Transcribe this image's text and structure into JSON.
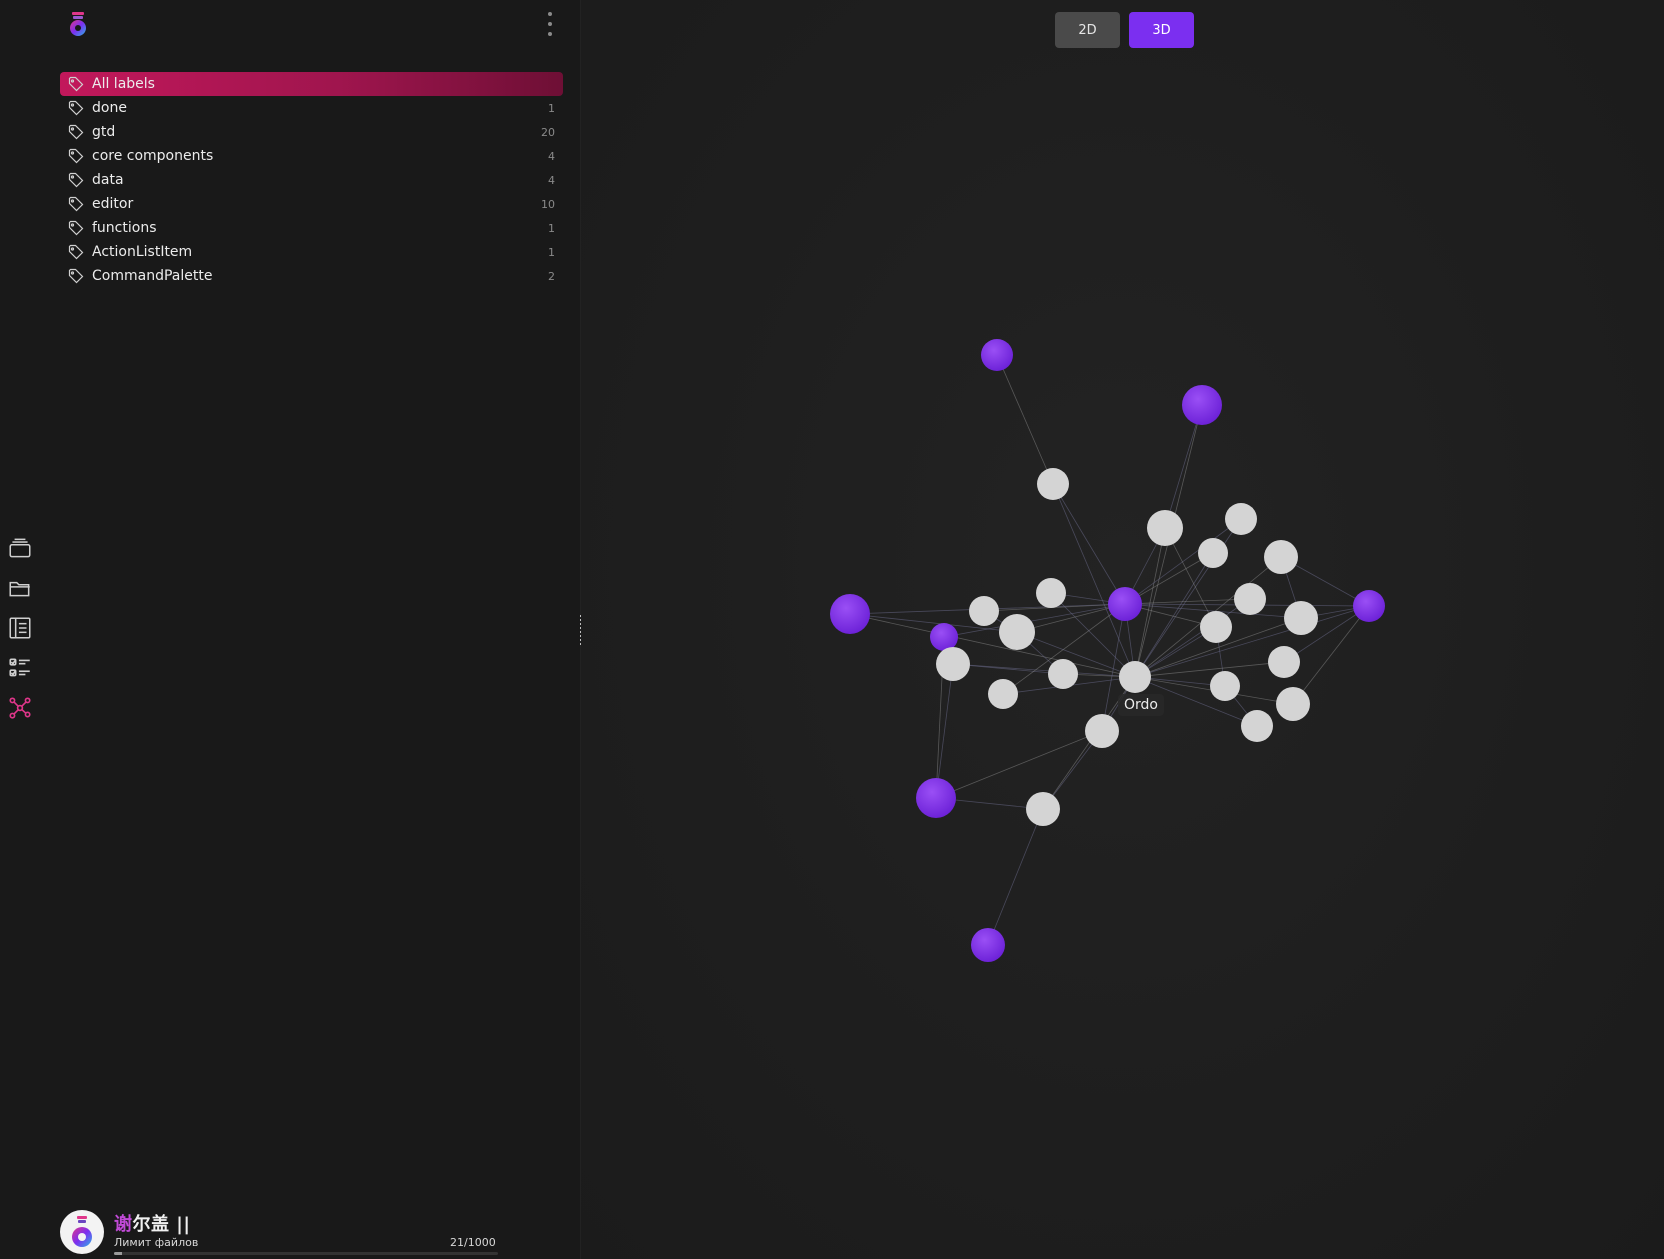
{
  "rail": {
    "items": [
      {
        "name": "inbox-icon"
      },
      {
        "name": "folder-icon"
      },
      {
        "name": "notes-icon"
      },
      {
        "name": "tasks-icon"
      },
      {
        "name": "graph-icon",
        "active": true
      }
    ]
  },
  "sidebar": {
    "labels": [
      {
        "text": "All labels",
        "count": "",
        "active": true
      },
      {
        "text": "done",
        "count": "1"
      },
      {
        "text": "gtd",
        "count": "20"
      },
      {
        "text": "core components",
        "count": "4"
      },
      {
        "text": "data",
        "count": "4"
      },
      {
        "text": "editor",
        "count": "10"
      },
      {
        "text": "functions",
        "count": "1"
      },
      {
        "text": "ActionListItem",
        "count": "1"
      },
      {
        "text": "CommandPalette",
        "count": "2"
      }
    ]
  },
  "user": {
    "name_accent": "谢",
    "name_rest": "尔盖 ||",
    "file_limit_label": "Лимит файлов",
    "file_limit_count": "21/1000",
    "file_limit_fraction": 0.021
  },
  "graph": {
    "mode_2d": "2D",
    "mode_3d": "3D",
    "active_mode": "3D",
    "tooltip": "Ordo",
    "colors": {
      "accent_pink": "#c2185b",
      "accent_purple": "#7b2ff0",
      "node_gray": "#d4d4d4"
    }
  }
}
